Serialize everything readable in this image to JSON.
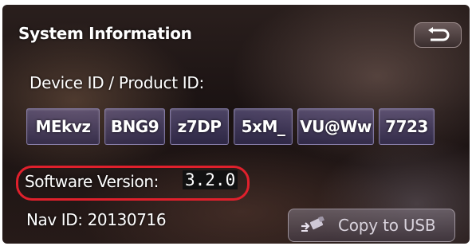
{
  "header": {
    "title": "System Information",
    "back_icon": "return-arrow-icon"
  },
  "device": {
    "label": "Device ID / Product ID:",
    "id_parts": [
      "MEkvz",
      "BNG9",
      "z7DP",
      "5xM_",
      "VU@Ww",
      "7723"
    ]
  },
  "software": {
    "label": "Software Version:",
    "value": "3.2.0",
    "highlight_color": "#e0202c"
  },
  "nav": {
    "label": "Nav ID: 20130716"
  },
  "actions": {
    "copy_label": "Copy to USB",
    "copy_icon": "usb-copy-icon"
  }
}
